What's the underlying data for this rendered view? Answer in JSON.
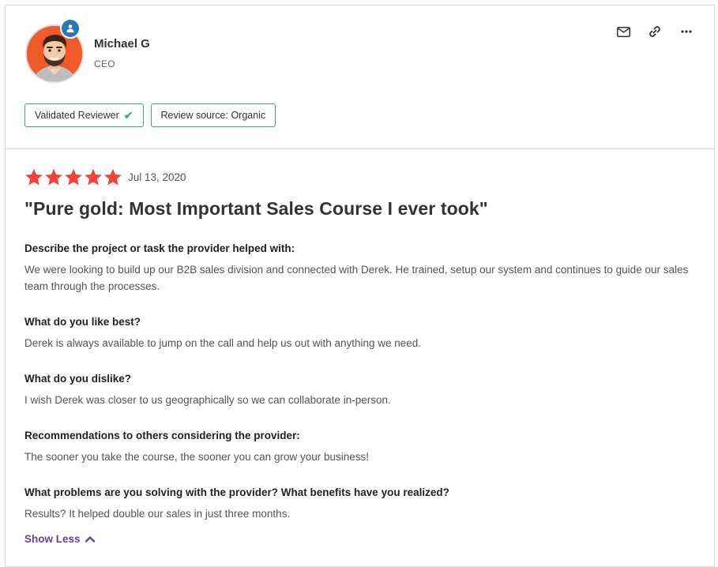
{
  "reviewer": {
    "name": "Michael G",
    "role": "CEO"
  },
  "tags": {
    "validated": "Validated Reviewer",
    "source": "Review source: Organic"
  },
  "review": {
    "rating": 5,
    "date": "Jul 13, 2020",
    "title": "\"Pure gold: Most Important Sales Course I ever took\"",
    "qa": [
      {
        "question": "Describe the project or task the provider helped with:",
        "answer": "We were looking to build up our B2B sales division and connected with Derek. He trained, setup our system and continues to guide our sales team through the processes."
      },
      {
        "question": "What do you like best?",
        "answer": "Derek is always available to jump on the call and help us out with anything we need."
      },
      {
        "question": "What do you dislike?",
        "answer": "I wish Derek was closer to us geographically so we can collaborate in-person."
      },
      {
        "question": "Recommendations to others considering the provider:",
        "answer": "The sooner you take the course, the sooner you can grow your business!"
      },
      {
        "question": "What problems are you solving with the provider? What benefits have you realized?",
        "answer": "Results? It helped double our sales in just three months."
      }
    ],
    "show_less_label": "Show Less"
  },
  "colors": {
    "star": "#f44336",
    "tag_border": "#3aa58a",
    "link": "#6441a5",
    "badge": "#2a78b3",
    "avatar_bg": "#f05a28"
  },
  "icons": {
    "email": "envelope-icon",
    "link": "link-icon",
    "more": "more-horizontal-icon"
  }
}
